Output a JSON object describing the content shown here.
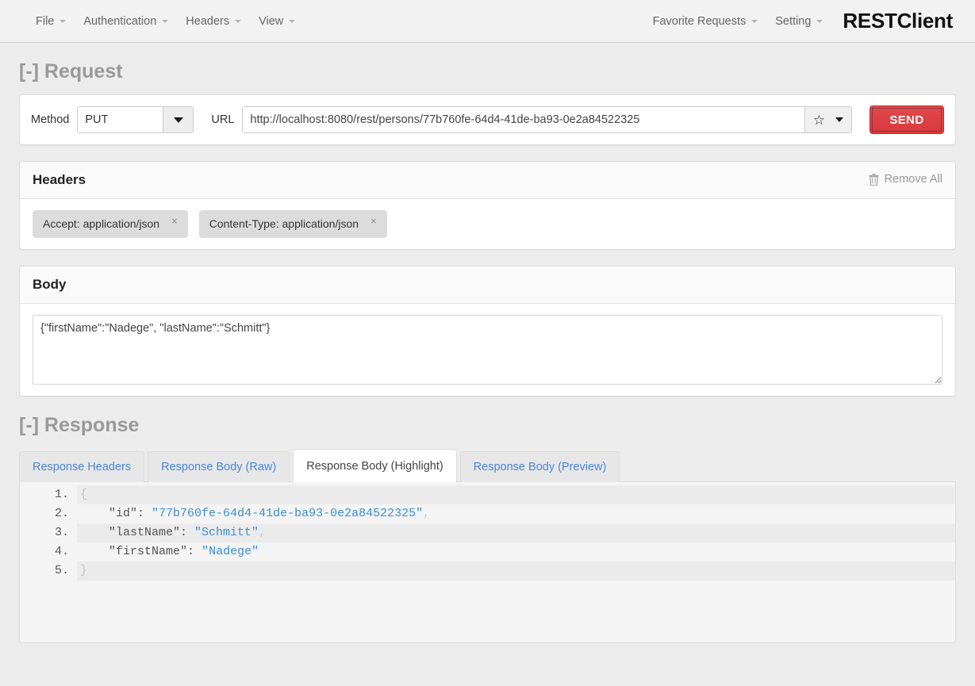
{
  "navbar": {
    "menus": [
      "File",
      "Authentication",
      "Headers",
      "View"
    ],
    "right_menus": [
      "Favorite Requests",
      "Setting"
    ],
    "brand": "RESTClient"
  },
  "request": {
    "section_label": "[-] Request",
    "method_label": "Method",
    "method_value": "PUT",
    "url_label": "URL",
    "url_value": "http://localhost:8080/rest/persons/77b760fe-64d4-41de-ba93-0e2a84522325",
    "url_placeholder": "URL",
    "favorite_icon": "star-icon",
    "send_label": "SEND",
    "send_color": "#d8393d"
  },
  "headers": {
    "title": "Headers",
    "remove_all_label": "Remove All",
    "items": [
      {
        "label": "Accept: application/json",
        "close": "×"
      },
      {
        "label": "Content-Type: application/json",
        "close": "×"
      }
    ]
  },
  "body": {
    "title": "Body",
    "value": "{\"firstName\":\"Nadege\", \"lastName\":\"Schmitt\"}",
    "placeholder": ""
  },
  "response": {
    "section_label": "[-] Response",
    "tabs": [
      {
        "label": "Response Headers",
        "active": false
      },
      {
        "label": "Response Body (Raw)",
        "active": false
      },
      {
        "label": "Response Body (Highlight)",
        "active": true
      },
      {
        "label": "Response Body (Preview)",
        "active": false
      }
    ],
    "code_lines": [
      {
        "n": "1.",
        "tokens": [
          {
            "t": "{",
            "c": "punct"
          }
        ]
      },
      {
        "n": "2.",
        "tokens": [
          {
            "t": "    ",
            "c": "punct"
          },
          {
            "t": "\"id\"",
            "c": "key"
          },
          {
            "t": ": ",
            "c": "key"
          },
          {
            "t": "\"77b760fe-64d4-41de-ba93-0e2a84522325\"",
            "c": "str"
          },
          {
            "t": ",",
            "c": "punct"
          }
        ]
      },
      {
        "n": "3.",
        "tokens": [
          {
            "t": "    ",
            "c": "punct"
          },
          {
            "t": "\"lastName\"",
            "c": "key"
          },
          {
            "t": ": ",
            "c": "key"
          },
          {
            "t": "\"Schmitt\"",
            "c": "str"
          },
          {
            "t": ",",
            "c": "punct"
          }
        ]
      },
      {
        "n": "4.",
        "tokens": [
          {
            "t": "    ",
            "c": "punct"
          },
          {
            "t": "\"firstName\"",
            "c": "key"
          },
          {
            "t": ": ",
            "c": "key"
          },
          {
            "t": "\"Nadege\"",
            "c": "str"
          }
        ]
      },
      {
        "n": "5.",
        "tokens": [
          {
            "t": "}",
            "c": "punct"
          }
        ]
      }
    ]
  }
}
